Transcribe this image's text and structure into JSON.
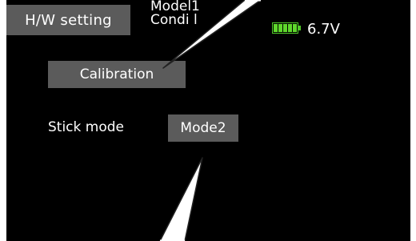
{
  "header": {
    "tab_label": "H/W setting",
    "model_line": "Model1",
    "condition_line": "Condi  l",
    "voltage": "6.7V"
  },
  "main": {
    "calibration_label": "Calibration",
    "stick_mode_label": "Stick mode",
    "stick_mode_value": "Mode2"
  },
  "colors": {
    "background": "#000000",
    "button": "#5b5b5b",
    "battery": "#5fd82c"
  }
}
